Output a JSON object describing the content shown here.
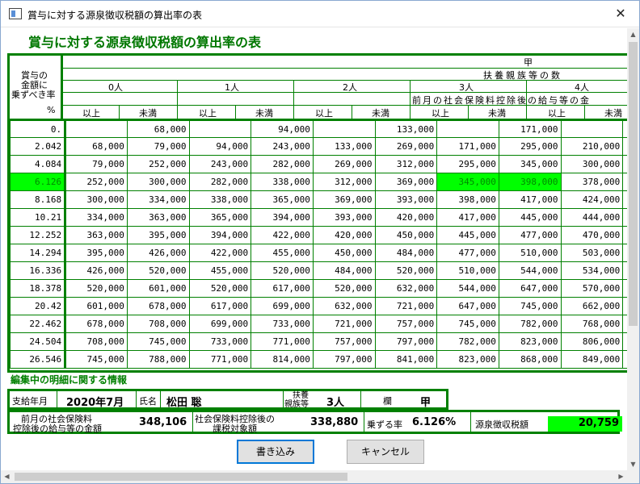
{
  "window": {
    "title": "賞与に対する源泉徴収税額の算出率の表",
    "close_symbol": "✕"
  },
  "heading": "賞与に対する源泉徴収税額の算出率の表",
  "table_header": {
    "kou": "甲",
    "dependents_title": "扶養親族等の数",
    "rate_label_lines": [
      "賞与の",
      "金額に",
      "乗ずべき率"
    ],
    "percent": "%",
    "dependents": [
      "0人",
      "1人",
      "2人",
      "3人",
      "4人"
    ],
    "prev_month_title": "前月の社会保険料控除後の給与等の金",
    "above": "以上",
    "below": "未満"
  },
  "rows": [
    {
      "rate": "0.",
      "v": [
        "",
        "68,000",
        "",
        "94,000",
        "",
        "133,000",
        "",
        "171,000",
        "",
        "210,00"
      ]
    },
    {
      "rate": "2.042",
      "v": [
        "68,000",
        "79,000",
        "94,000",
        "243,000",
        "133,000",
        "269,000",
        "171,000",
        "295,000",
        "210,000",
        "300,00"
      ]
    },
    {
      "rate": "4.084",
      "v": [
        "79,000",
        "252,000",
        "243,000",
        "282,000",
        "269,000",
        "312,000",
        "295,000",
        "345,000",
        "300,000",
        "378,00"
      ]
    },
    {
      "rate": "6.126",
      "v": [
        "252,000",
        "300,000",
        "282,000",
        "338,000",
        "312,000",
        "369,000",
        "345,000",
        "398,000",
        "378,000",
        "424,00"
      ],
      "highlight": true
    },
    {
      "rate": "8.168",
      "v": [
        "300,000",
        "334,000",
        "338,000",
        "365,000",
        "369,000",
        "393,000",
        "398,000",
        "417,000",
        "424,000",
        "444,00"
      ]
    },
    {
      "rate": "10.21",
      "v": [
        "334,000",
        "363,000",
        "365,000",
        "394,000",
        "393,000",
        "420,000",
        "417,000",
        "445,000",
        "444,000",
        "470,00"
      ]
    },
    {
      "rate": "12.252",
      "v": [
        "363,000",
        "395,000",
        "394,000",
        "422,000",
        "420,000",
        "450,000",
        "445,000",
        "477,000",
        "470,000",
        "503,00"
      ]
    },
    {
      "rate": "14.294",
      "v": [
        "395,000",
        "426,000",
        "422,000",
        "455,000",
        "450,000",
        "484,000",
        "477,000",
        "510,000",
        "503,000",
        "534,00"
      ]
    },
    {
      "rate": "16.336",
      "v": [
        "426,000",
        "520,000",
        "455,000",
        "520,000",
        "484,000",
        "520,000",
        "510,000",
        "544,000",
        "534,000",
        "570,00"
      ]
    },
    {
      "rate": "18.378",
      "v": [
        "520,000",
        "601,000",
        "520,000",
        "617,000",
        "520,000",
        "632,000",
        "544,000",
        "647,000",
        "570,000",
        "662,00"
      ]
    },
    {
      "rate": "20.42",
      "v": [
        "601,000",
        "678,000",
        "617,000",
        "699,000",
        "632,000",
        "721,000",
        "647,000",
        "745,000",
        "662,000",
        "768,00"
      ]
    },
    {
      "rate": "22.462",
      "v": [
        "678,000",
        "708,000",
        "699,000",
        "733,000",
        "721,000",
        "757,000",
        "745,000",
        "782,000",
        "768,000",
        "806,00"
      ]
    },
    {
      "rate": "24.504",
      "v": [
        "708,000",
        "745,000",
        "733,000",
        "771,000",
        "757,000",
        "797,000",
        "782,000",
        "823,000",
        "806,000",
        "845,00"
      ]
    },
    {
      "rate": "26.546",
      "v": [
        "745,000",
        "788,000",
        "771,000",
        "814,000",
        "797,000",
        "841,000",
        "823,000",
        "868,000",
        "849,000",
        "896,00"
      ]
    }
  ],
  "detail": {
    "title": "編集中の明細に関する情報",
    "pay_month_label": "支給年月",
    "pay_month": "2020年7月",
    "name_label": "氏名",
    "name": "松田 聡",
    "dependents_label_lines": [
      "扶養",
      "親族等"
    ],
    "dependents": "3人",
    "column_label": "欄",
    "column": "甲",
    "prev_salary_label_lines": [
      "前月の社会保険料",
      "控除後の給与等の金額"
    ],
    "prev_salary": "348,106",
    "insurance_label_lines": [
      "社会保険料控除後の",
      "課税対象額"
    ],
    "insurance_amount": "338,880",
    "rate_label": "乗ずる率",
    "rate": "6.126%",
    "tax_label": "源泉徴収税額",
    "tax": "20,759"
  },
  "buttons": {
    "write": "書き込み",
    "cancel": "キャンセル"
  },
  "colors": {
    "grid": "#008000",
    "highlight": "#00ff00",
    "heading": "#007700"
  }
}
